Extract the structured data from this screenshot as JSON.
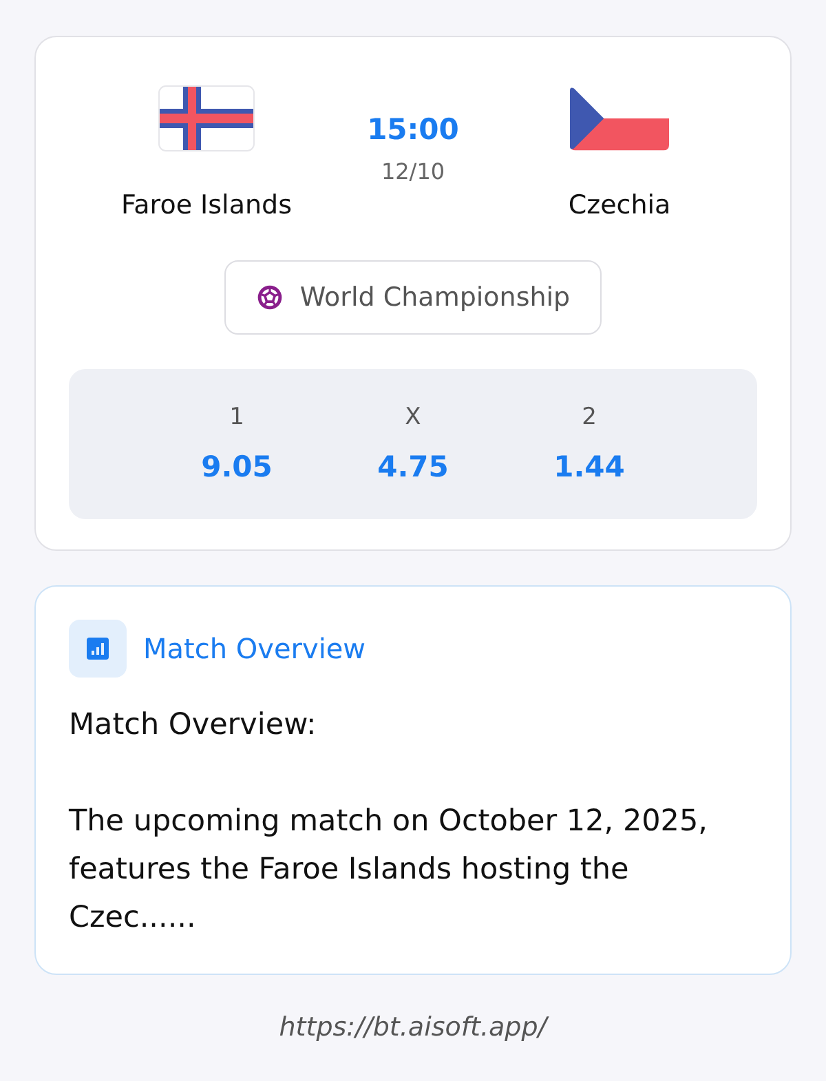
{
  "match": {
    "home": {
      "name": "Faroe Islands"
    },
    "time": "15:00",
    "date": "12/10",
    "away": {
      "name": "Czechia"
    },
    "competition": "World Championship"
  },
  "odds": [
    {
      "label": "1",
      "value": "9.05"
    },
    {
      "label": "X",
      "value": "4.75"
    },
    {
      "label": "2",
      "value": "1.44"
    }
  ],
  "overview": {
    "title": "Match Overview",
    "paragraphs": [
      "Match Overview:",
      "The upcoming match on October 12, 2025, features the Faroe Islands hosting the Czec......"
    ]
  },
  "footer": {
    "url": "https://bt.aisoft.app/"
  }
}
